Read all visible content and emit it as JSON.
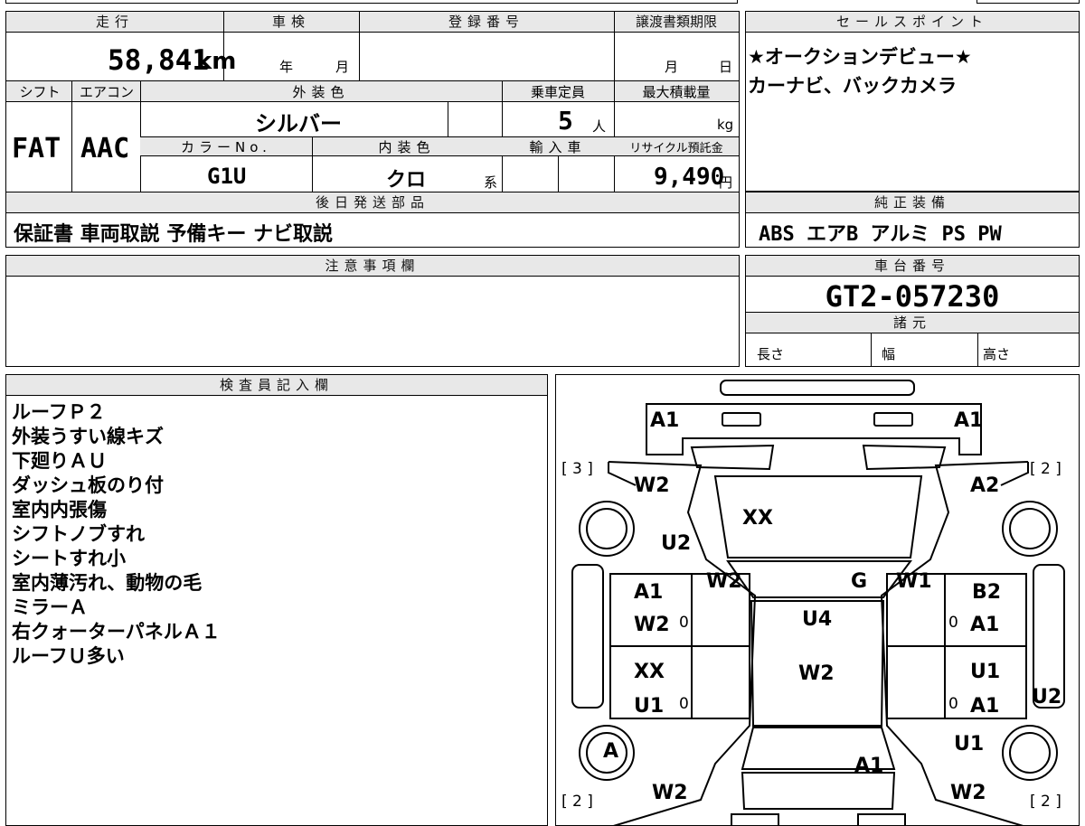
{
  "top": {
    "mileage_label": "走行",
    "mileage_value": "58,841",
    "mileage_unit": "km",
    "shaken_label": "車検",
    "shaken_year": "年",
    "shaken_month": "月",
    "registration_label": "登録番号",
    "registration_value": "",
    "transfer_label": "譲渡書類期限",
    "transfer_month": "月",
    "transfer_day": "日"
  },
  "specs": {
    "shift_label": "シフト",
    "shift_value": "FAT",
    "aircon_label": "エアコン",
    "aircon_value": "AAC",
    "exterior_label": "外装色",
    "exterior_value": "シルバー",
    "capacity_label": "乗車定員",
    "capacity_value": "5",
    "capacity_unit": "人",
    "maxload_label": "最大積載量",
    "maxload_unit": "kg",
    "colorno_label": "カラーNo.",
    "colorno_value": "G1U",
    "interior_label": "内装色",
    "interior_value": "クロ",
    "interior_suffix": "系",
    "import_label": "輸入車",
    "recycle_label": "リサイクル預託金",
    "recycle_value": "9,490",
    "recycle_unit": "円"
  },
  "later_parts": {
    "label": "後日発送部品",
    "value": "保証書 車両取説 予備キー ナビ取説"
  },
  "selling_points": {
    "label": "セールスポイント",
    "lines": [
      "★オークションデビュー★",
      "カーナビ、バックカメラ"
    ]
  },
  "equipment": {
    "label": "純正装備",
    "value": "ABS エアB アルミ PS PW"
  },
  "notes": {
    "label": "注意事項欄"
  },
  "chassis": {
    "label": "車台番号",
    "value": "GT2-057230"
  },
  "dimensions": {
    "label": "諸元",
    "length_label": "長さ",
    "width_label": "幅",
    "height_label": "高さ"
  },
  "inspector": {
    "label": "検査員記入欄",
    "lines": [
      "ルーフＰ２",
      "外装うすい線キズ",
      "下廻りＡＵ",
      "ダッシュ板のり付",
      "室内内張傷",
      "シフトノブすれ",
      "シートすれ小",
      "室内薄汚れ、動物の毛",
      "ミラーＡ",
      "右クォーターパネルＡ１",
      "ルーフＵ多い"
    ]
  },
  "diagram": {
    "marks": {
      "front_left": "A1",
      "front_right": "A1",
      "fl_fender_w": "W2",
      "fr_fender_a": "A2",
      "fl_fender_u": "U2",
      "hood": "XX",
      "a_pillar_left": "W2",
      "windshield": "G",
      "a_pillar_right": "W1",
      "left_front_door_a": "A1",
      "left_front_door_w": "W2",
      "right_front_door_b": "B2",
      "right_front_door_a": "A1",
      "roof": "U4",
      "roof_rear": "W2",
      "left_rear_door_x": "XX",
      "left_rear_door_u": "U1",
      "right_rear_door_u": "U1",
      "right_rear_door_a": "A1",
      "right_side_step": "U2",
      "left_rear_wheel": "A",
      "right_rear_quarter": "U1",
      "trunk": "A1",
      "rear_left_w": "W2",
      "rear_right_w": "W2",
      "zero1": "0",
      "zero2": "0",
      "zero3": "0",
      "zero4": "0"
    },
    "bracket_fl": "[ 3 ]",
    "bracket_fr": "[ 2 ]",
    "bracket_rl": "[ 2 ]",
    "bracket_rr": "[ 2 ]"
  }
}
